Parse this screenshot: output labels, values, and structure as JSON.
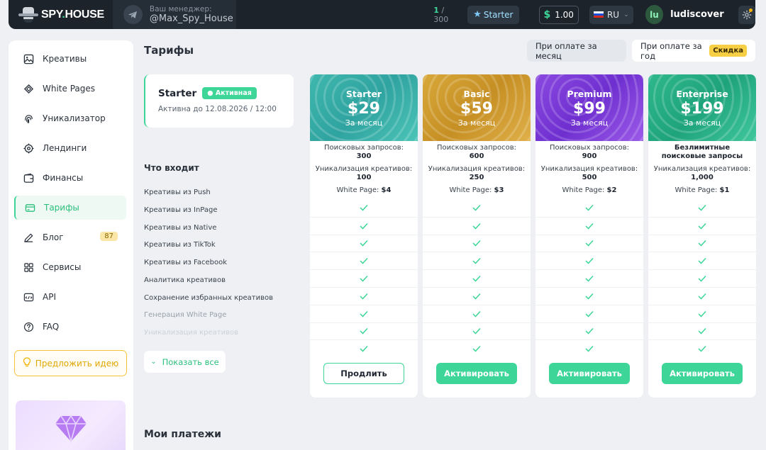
{
  "header": {
    "logo_text_a": "SPY",
    "logo_text_dot": ".",
    "logo_text_b": "HOUSE",
    "manager_label": "Ваш менеджер:",
    "manager_handle": "@Max_Spy_House",
    "quota_used": "1",
    "quota_total": " / 300",
    "current_plan": "Starter",
    "balance": "1.00",
    "balance_symbol": "$",
    "language": "RU",
    "avatar_initials": "lu",
    "username": "ludiscover"
  },
  "sidebar": {
    "items": [
      {
        "label": "Креативы",
        "icon": "image-icon"
      },
      {
        "label": "White Pages",
        "icon": "layers-icon"
      },
      {
        "label": "Уникализатор",
        "icon": "fingerprint-icon"
      },
      {
        "label": "Лендинги",
        "icon": "target-icon"
      },
      {
        "label": "Финансы",
        "icon": "wallet-icon"
      },
      {
        "label": "Тарифы",
        "icon": "card-icon",
        "active": true
      },
      {
        "label": "Блог",
        "icon": "pen-icon",
        "badge": "87"
      },
      {
        "label": "Сервисы",
        "icon": "grid-icon"
      },
      {
        "label": "API",
        "icon": "api-icon"
      },
      {
        "label": "FAQ",
        "icon": "question-icon"
      }
    ],
    "idea_button": "Предложить идею"
  },
  "main": {
    "title": "Тарифы",
    "billing_month": "При оплате за месяц",
    "billing_year": "При оплате за год",
    "discount_badge": "Скидка",
    "current_plan": {
      "name": "Starter",
      "status": "Активная",
      "until": "Активна до 12.08.2026 / 12:00"
    },
    "includes_title": "Что входит",
    "features": [
      "Креативы из Push",
      "Креативы из InPage",
      "Креативы из Native",
      "Креативы из TikTok",
      "Креативы из Facebook",
      "Аналитика креативов",
      "Сохранение избранных креативов",
      "Генерация White Page",
      "Уникализация креативов"
    ],
    "show_all": "Показать все",
    "payments_title": "Мои платежи"
  },
  "plans": [
    {
      "name": "Starter",
      "price": "$29",
      "period": "За месяц",
      "search_label": "Поисковых запросов:",
      "search_value": "300",
      "uniq_label": "Уникализация креативов:",
      "uniq_value": "100",
      "wp_label": "White Page:",
      "wp_value": "$4",
      "button": "Продлить"
    },
    {
      "name": "Basic",
      "price": "$59",
      "period": "За месяц",
      "search_label": "Поисковых запросов:",
      "search_value": "600",
      "uniq_label": "Уникализация креативов:",
      "uniq_value": "250",
      "wp_label": "White Page:",
      "wp_value": "$3",
      "button": "Активировать"
    },
    {
      "name": "Premium",
      "price": "$99",
      "period": "За месяц",
      "search_label": "Поисковых запросов:",
      "search_value": "900",
      "uniq_label": "Уникализация креативов:",
      "uniq_value": "500",
      "wp_label": "White Page:",
      "wp_value": "$2",
      "button": "Активировать"
    },
    {
      "name": "Enterprise",
      "price": "$199",
      "period": "За месяц",
      "search_label": "",
      "search_value": "Безлимитные поисковые запросы",
      "uniq_label": "Уникализация креативов:",
      "uniq_value": "1,000",
      "wp_label": "White Page:",
      "wp_value": "$1",
      "button": "Активировать"
    }
  ],
  "colors": {
    "accent": "#3dd598",
    "topbar": "#1d232b",
    "badge_yellow": "#f7cf45"
  }
}
